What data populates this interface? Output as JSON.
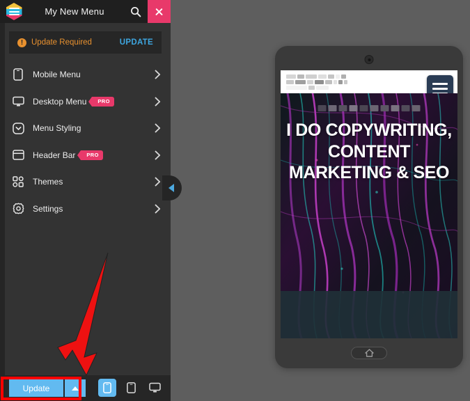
{
  "panel": {
    "title": "My New Menu",
    "logo_icon": "hexagon-menu-logo-icon",
    "search_icon": "search-icon",
    "close_icon": "close-icon"
  },
  "banner": {
    "warn_icon": "warning-exclamation-icon",
    "warn_glyph": "!",
    "text": "Update Required",
    "action": "UPDATE"
  },
  "menu": {
    "items": [
      {
        "label": "Mobile Menu",
        "icon": "mobile-phone-icon",
        "pro": false,
        "chevron": "chevron-right-icon"
      },
      {
        "label": "Desktop Menu",
        "icon": "desktop-monitor-icon",
        "pro": true,
        "badge": "PRO",
        "chevron": "chevron-right-icon"
      },
      {
        "label": "Menu Styling",
        "icon": "circle-chevron-down-icon",
        "pro": false,
        "chevron": "chevron-right-icon"
      },
      {
        "label": "Header Bar",
        "icon": "header-bar-window-icon",
        "pro": true,
        "badge": "PRO",
        "chevron": "chevron-right-icon"
      },
      {
        "label": "Themes",
        "icon": "grid-squares-icon",
        "pro": false,
        "chevron": "chevron-right-icon"
      },
      {
        "label": "Settings",
        "icon": "gear-icon",
        "pro": false,
        "chevron": "chevron-right-icon"
      }
    ]
  },
  "collapse": {
    "icon": "collapse-left-triangle-icon"
  },
  "bottom": {
    "update_label": "Update",
    "caret_icon": "caret-up-icon",
    "devices": [
      {
        "name": "mobile",
        "icon": "mobile-phone-icon",
        "active": true
      },
      {
        "name": "tablet",
        "icon": "tablet-icon",
        "active": false
      },
      {
        "name": "desktop",
        "icon": "desktop-monitor-icon",
        "active": false
      }
    ]
  },
  "annotation": {
    "arrow_icon": "red-down-arrow-annotation",
    "highlight_color": "#ff0000",
    "arrow_color": "#ee1111"
  },
  "preview": {
    "camera_icon": "front-camera-icon",
    "site_logo": "blurred-site-logo",
    "burger_icon": "hamburger-menu-icon",
    "hero_eyebrow": "blurred-eyebrow-text",
    "hero_title": "I DO COPYWRITING, CONTENT MARKETING & SEO",
    "home_icon": "home-icon"
  },
  "colors": {
    "accent_pink": "#e8396a",
    "accent_blue": "#62baf0",
    "link_blue": "#3ea6e0",
    "warning_orange": "#e8912f",
    "panel_bg": "#333333",
    "header_bg": "#1f1f1f",
    "workspace_bg": "#5e5e5e"
  }
}
